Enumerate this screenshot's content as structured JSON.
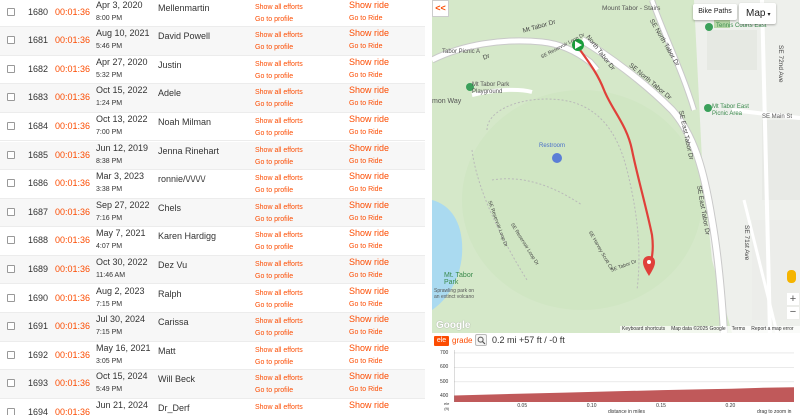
{
  "efforts": [
    {
      "rank": "1680",
      "time": "00:01:36",
      "date": "Apr 3, 2020",
      "clock": "8:00 PM",
      "athlete": "Mellenmartin"
    },
    {
      "rank": "1681",
      "time": "00:01:36",
      "date": "Aug 10, 2021",
      "clock": "5:46 PM",
      "athlete": "David Powell"
    },
    {
      "rank": "1682",
      "time": "00:01:36",
      "date": "Apr 27, 2020",
      "clock": "5:32 PM",
      "athlete": "Justin"
    },
    {
      "rank": "1683",
      "time": "00:01:36",
      "date": "Oct 15, 2022",
      "clock": "1:24 PM",
      "athlete": "Adele"
    },
    {
      "rank": "1684",
      "time": "00:01:36",
      "date": "Oct 13, 2022",
      "clock": "7:00 PM",
      "athlete": "Noah Milman"
    },
    {
      "rank": "1685",
      "time": "00:01:36",
      "date": "Jun 12, 2019",
      "clock": "8:38 PM",
      "athlete": "Jenna Rinehart"
    },
    {
      "rank": "1686",
      "time": "00:01:36",
      "date": "Mar 3, 2023",
      "clock": "3:38 PM",
      "athlete": "ronnie/\\/\\/\\/\\/"
    },
    {
      "rank": "1687",
      "time": "00:01:36",
      "date": "Sep 27, 2022",
      "clock": "7:16 PM",
      "athlete": "Chels"
    },
    {
      "rank": "1688",
      "time": "00:01:36",
      "date": "May 7, 2021",
      "clock": "4:07 PM",
      "athlete": "Karen Hardigg"
    },
    {
      "rank": "1689",
      "time": "00:01:36",
      "date": "Oct 30, 2022",
      "clock": "11:46 AM",
      "athlete": "Dez Vu"
    },
    {
      "rank": "1690",
      "time": "00:01:36",
      "date": "Aug 2, 2023",
      "clock": "7:15 PM",
      "athlete": "Ralph"
    },
    {
      "rank": "1691",
      "time": "00:01:36",
      "date": "Jul 30, 2024",
      "clock": "7:15 PM",
      "athlete": "Carissa"
    },
    {
      "rank": "1692",
      "time": "00:01:36",
      "date": "May 16, 2021",
      "clock": "3:05 PM",
      "athlete": "Matt"
    },
    {
      "rank": "1693",
      "time": "00:01:36",
      "date": "Oct 15, 2024",
      "clock": "5:49 PM",
      "athlete": "Will Beck"
    },
    {
      "rank": "1694",
      "time": "00:01:36",
      "date": "Jun 21, 2024",
      "clock": "",
      "athlete": "Dr_Derf"
    }
  ],
  "row_links": {
    "show_all_efforts": "Show all efforts",
    "go_to_profile": "Go to profile",
    "show_ride": "Show ride",
    "go_to_ride": "Go to Ride"
  },
  "colors": {
    "accent": "#fc4c02",
    "route": "#e0403a",
    "park": "#cfe5c3",
    "elevation_fill": "#c0595a"
  },
  "map": {
    "collapse_icon": "collapse-arrows-icon",
    "collapse_glyph": "<<",
    "bike_paths_label": "Bike Paths",
    "map_type_label": "Map",
    "map_type_chevron": "▾",
    "google_logo": "Google",
    "attribution": {
      "shortcuts": "Keyboard shortcuts",
      "data": "Map data ©2025 Google",
      "terms": "Terms",
      "report": "Report a map error"
    },
    "zoom_in": "+",
    "zoom_out": "−",
    "poi_labels": {
      "mount_tabor_stairs": "Mount Tabor - Stairs",
      "tennis_courts": "Tennis Courts East",
      "playground": "Mt Tabor Park\nPlayground",
      "picnic_a": "Tabor Picnic A",
      "picnic_east": "Mt Tabor East\nPicnic Area",
      "restroom": "Restroom",
      "park_name": "Mt. Tabor\nPark",
      "park_desc": "Sprawling park on\nan extinct volcano",
      "se_main": "SE Main St",
      "se_72nd": "SE 72nd Ave",
      "se_71st": "SE 71st Ave",
      "mon_way": "mon Way"
    },
    "road_labels": {
      "north_tabor_1": "North Tabor Dr",
      "north_tabor_2": "SE North Tabor Dr",
      "north_tabor_3": "SE North Tabor Dr",
      "east_tabor_1": "SE East Tabor Dr",
      "east_tabor_2": "SE East Tabor Dr",
      "tabor_dr": "Mt Tabor Dr",
      "reservoir_1": "SE Reservoir Loop Dr",
      "reservoir_2": "SE Reservoir Loop Dr",
      "reservoir_3": "SE Reservoir Loop Dr",
      "harvey_scott": "SE Harvey Scott Cir",
      "se_tabor": "SE Tabor Dr",
      "ne_dr": "Dr"
    }
  },
  "profile": {
    "tab_ele": "ele",
    "tab_grade": "grade",
    "summary": "0.2 mi +57 ft / -0 ft",
    "y_ticks": [
      "700",
      "600",
      "500",
      "400"
    ],
    "ele_unit": "ele\n(ft)",
    "x_ticks": [
      "0.05",
      "0.10",
      "0.15",
      "0.20"
    ],
    "x_title": "distance in miles",
    "zoom_hint": "drag to zoom in"
  },
  "chart_data": {
    "type": "area",
    "title": "",
    "xlabel": "distance in miles",
    "ylabel": "ele (ft)",
    "xlim": [
      0,
      0.245
    ],
    "ylim": [
      360,
      720
    ],
    "x": [
      0,
      0.02,
      0.05,
      0.08,
      0.1,
      0.12,
      0.15,
      0.18,
      0.2,
      0.22,
      0.245
    ],
    "series": [
      {
        "values": [
          405,
          410,
          418,
          425,
          430,
          435,
          442,
          448,
          452,
          458,
          462
        ]
      }
    ]
  }
}
